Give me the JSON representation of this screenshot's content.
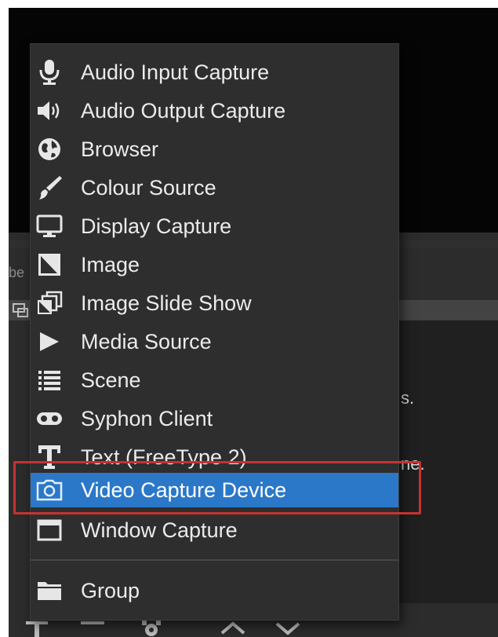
{
  "background": {
    "cut_left_text": "be",
    "cut_text_1": "s.",
    "cut_text_2": "ne."
  },
  "menu": {
    "items": [
      {
        "label": "Audio Input Capture",
        "icon": "microphone-icon"
      },
      {
        "label": "Audio Output Capture",
        "icon": "speaker-icon"
      },
      {
        "label": "Browser",
        "icon": "globe-icon"
      },
      {
        "label": "Colour Source",
        "icon": "paintbrush-icon"
      },
      {
        "label": "Display Capture",
        "icon": "monitor-icon"
      },
      {
        "label": "Image",
        "icon": "image-icon"
      },
      {
        "label": "Image Slide Show",
        "icon": "slideshow-icon"
      },
      {
        "label": "Media Source",
        "icon": "play-icon"
      },
      {
        "label": "Scene",
        "icon": "list-icon"
      },
      {
        "label": "Syphon Client",
        "icon": "gamepad-icon"
      },
      {
        "label": "Text (FreeType 2)",
        "icon": "text-icon"
      },
      {
        "label": "Video Capture Device",
        "icon": "camera-icon",
        "selected": true
      },
      {
        "label": "Window Capture",
        "icon": "window-icon"
      },
      {
        "label": "Group",
        "icon": "folder-icon"
      }
    ]
  },
  "colors": {
    "selection": "#2b78c9",
    "highlight_border": "#c63232",
    "menu_bg": "#2e2e2e"
  }
}
